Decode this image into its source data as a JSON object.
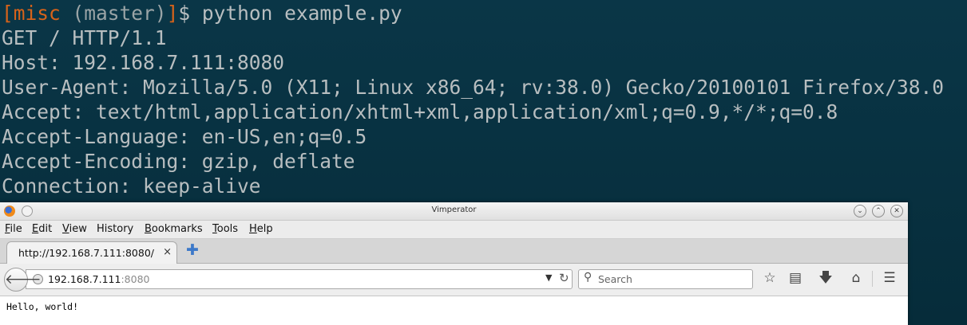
{
  "terminal": {
    "prompt": {
      "open_bracket": "[",
      "dir": "misc",
      "branch": "(master)",
      "close_bracket": "]",
      "symbol": "$",
      "command": "python example.py"
    },
    "output_lines": [
      "GET / HTTP/1.1",
      "Host: 192.168.7.111:8080",
      "User-Agent: Mozilla/5.0 (X11; Linux x86_64; rv:38.0) Gecko/20100101 Firefox/38.0",
      "Accept: text/html,application/xhtml+xml,application/xml;q=0.9,*/*;q=0.8",
      "Accept-Language: en-US,en;q=0.5",
      "Accept-Encoding: gzip, deflate",
      "Connection: keep-alive"
    ],
    "colors": {
      "background": "#06303f",
      "text": "#b8bec0",
      "prompt_accent": "#d7631a"
    }
  },
  "browser": {
    "window_title": "Vimperator",
    "window_buttons": [
      "chevron-down-icon",
      "chevron-up-icon",
      "close-icon"
    ],
    "menu": [
      {
        "accel": "F",
        "rest": "ile"
      },
      {
        "accel": "E",
        "rest": "dit"
      },
      {
        "accel": "V",
        "rest": "iew"
      },
      {
        "accel": "",
        "rest": "History"
      },
      {
        "accel": "B",
        "rest": "ookmarks"
      },
      {
        "accel": "T",
        "rest": "ools"
      },
      {
        "accel": "H",
        "rest": "elp"
      }
    ],
    "tab": {
      "label": "http://192.168.7.111:8080/",
      "close": "×"
    },
    "new_tab": "✚",
    "url": {
      "host": "192.168.7.111",
      "port": ":8080"
    },
    "search": {
      "placeholder": "Search"
    },
    "toolbar_icons": [
      "star-icon",
      "reading-list-icon",
      "download-icon",
      "home-icon",
      "menu-icon"
    ],
    "page_content": "Hello, world!"
  }
}
